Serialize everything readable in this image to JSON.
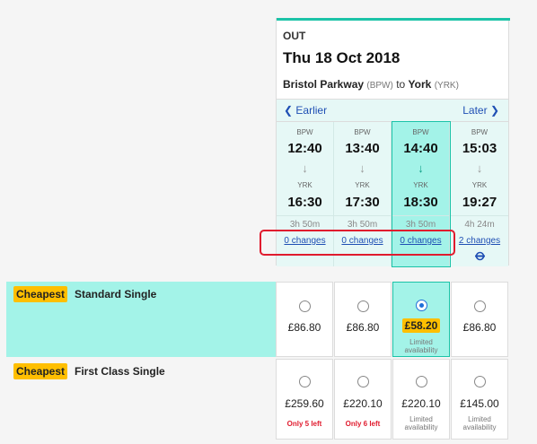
{
  "journey": {
    "direction": "OUT",
    "date": "Thu 18 Oct 2018",
    "from_name": "Bristol Parkway",
    "from_code": "(BPW)",
    "to_word": "to",
    "to_name": "York",
    "to_code": "(YRK)",
    "earlier_label": "Earlier",
    "later_label": "Later"
  },
  "trains": [
    {
      "from": "BPW",
      "dep": "12:40",
      "to": "YRK",
      "arr": "16:30",
      "duration": "3h 50m",
      "changes": "0 changes"
    },
    {
      "from": "BPW",
      "dep": "13:40",
      "to": "YRK",
      "arr": "17:30",
      "duration": "3h 50m",
      "changes": "0 changes"
    },
    {
      "from": "BPW",
      "dep": "14:40",
      "to": "YRK",
      "arr": "18:30",
      "duration": "3h 50m",
      "changes": "0 changes"
    },
    {
      "from": "BPW",
      "dep": "15:03",
      "to": "YRK",
      "arr": "19:27",
      "duration": "4h 24m",
      "changes": "2 changes"
    }
  ],
  "fares": {
    "standard": {
      "badge": "Cheapest",
      "name": "Standard Single",
      "prices": [
        "£86.80",
        "£86.80",
        "£58.20",
        "£86.80"
      ],
      "notes": [
        "",
        "",
        "Limited availability",
        ""
      ]
    },
    "first": {
      "badge": "Cheapest",
      "name": "First Class Single",
      "prices": [
        "£259.60",
        "£220.10",
        "£220.10",
        "£145.00"
      ],
      "notes": [
        "Only 5 left",
        "Only 6 left",
        "Limited availability",
        "Limited availability"
      ]
    }
  },
  "colors": {
    "accent": "#1cc3a8",
    "selected_bg": "#a3f3e8",
    "badge": "#ffbf00",
    "link": "#1f4fb4",
    "highlight_box": "#e01b2e"
  }
}
